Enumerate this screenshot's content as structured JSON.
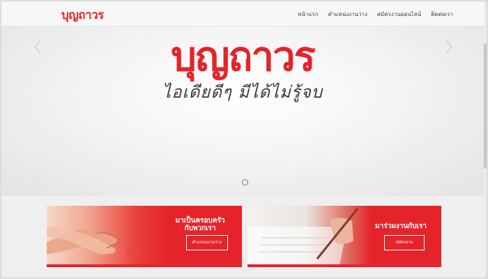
{
  "header": {
    "logo_text": "บุญถาวร",
    "nav": [
      {
        "label": "หน้าแรก"
      },
      {
        "label": "ตำแหน่งงานว่าง"
      },
      {
        "label": "สมัครงานออนไลน์"
      },
      {
        "label": "ติดต่อเรา"
      }
    ]
  },
  "hero": {
    "logo_text": "บุญถาวร",
    "tagline": "ไอเดียดีๆ มีได้ไม่รู้จบ",
    "slide_count": 1,
    "active_slide": 1
  },
  "banners": [
    {
      "title_line1": "มาเป็นครอบครัว",
      "title_line2": "กับพวกเรา",
      "button": "ตำแหน่งงานว่าง"
    },
    {
      "title_line1": "มาร่วมงานกับเรา",
      "title_line2": "",
      "button": "สมัครงาน"
    }
  ],
  "colors": {
    "brand_red": "#e5232a",
    "nav_text": "#444444",
    "header_bg": "#f7f7f7"
  },
  "icons": [
    "chevron-left-icon",
    "chevron-right-icon",
    "handshake-image",
    "pen-document-image"
  ]
}
